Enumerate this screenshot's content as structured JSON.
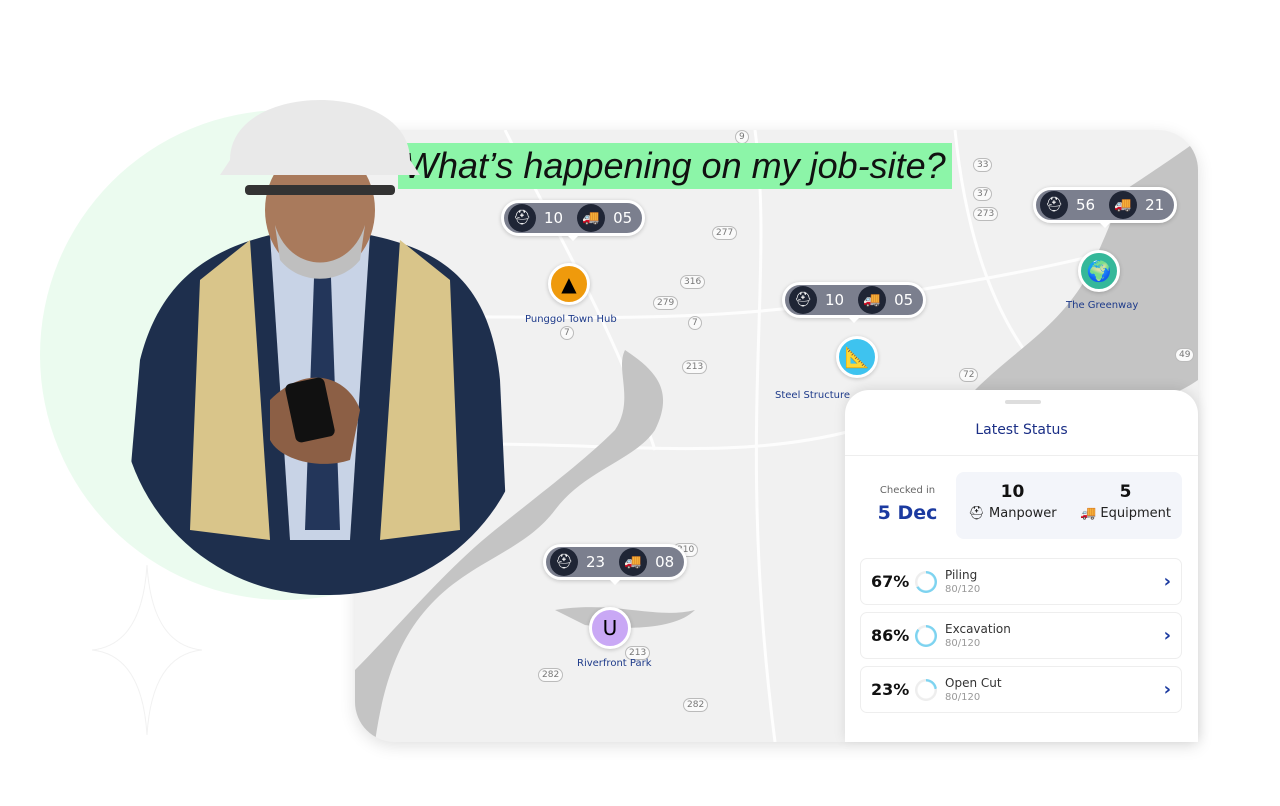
{
  "headline": "What’s happening on my job-site?",
  "colors": {
    "accent": "#1b3aa0",
    "highlight": "#8cf5a8",
    "pill": "#7b7f8e",
    "ring": "#7dd3f0"
  },
  "map": {
    "routes": [
      "9",
      "33",
      "37",
      "273",
      "277",
      "316",
      "279",
      "7",
      "7",
      "213",
      "72",
      "49",
      "310",
      "213",
      "282",
      "282"
    ],
    "sites": [
      {
        "name": "Punggol Town Hub",
        "manpower": "10",
        "equipment": "05",
        "icon": "traffic-cone-icon",
        "color": "#ef9a0c"
      },
      {
        "name": "Steel Structure",
        "manpower": "10",
        "equipment": "05",
        "icon": "ruler-pencil-icon",
        "color": "#3ec3ef"
      },
      {
        "name": "The Greenway",
        "manpower": "56",
        "equipment": "21",
        "icon": "globe-icon",
        "color": "#35b89a"
      },
      {
        "name": "Riverfront Park",
        "manpower": "23",
        "equipment": "08",
        "icon": "magnet-icon",
        "color": "#c9a8f5"
      }
    ]
  },
  "panel": {
    "title": "Latest Status",
    "checked_label": "Checked in",
    "checked_date": "5 Dec",
    "manpower_value": "10",
    "manpower_label": "Manpower",
    "equipment_value": "5",
    "equipment_label": "Equipment",
    "tasks": [
      {
        "percent": "67%",
        "name": "Piling",
        "progress": "80/120",
        "fill": 67
      },
      {
        "percent": "86%",
        "name": "Excavation",
        "progress": "80/120",
        "fill": 86
      },
      {
        "percent": "23%",
        "name": "Open Cut",
        "progress": "80/120",
        "fill": 23
      }
    ]
  }
}
